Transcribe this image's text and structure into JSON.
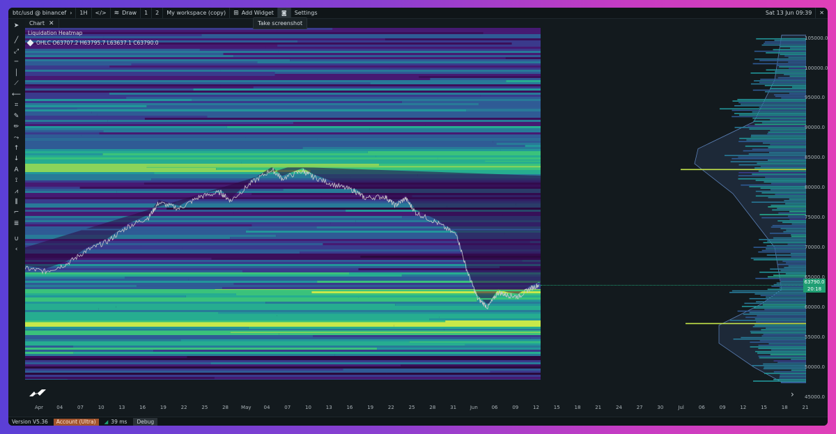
{
  "topbar": {
    "symbol": "btc/usd @ binancef",
    "timeframe": "1H",
    "draw_label": "Draw",
    "layout_1": "1",
    "layout_2": "2",
    "workspace": "My workspace (copy)",
    "add_widget": "Add Widget",
    "settings": "Settings",
    "datetime": "Sat 13 Jun  09:39",
    "close": "✕"
  },
  "tooltip": "Take screenshot",
  "tabs": [
    {
      "label": "Chart"
    }
  ],
  "chart": {
    "title": "Liquidation Heatmap",
    "ohlc": "OHLC  O63707.2 H63795.7 L63637.1 C63790.0",
    "current_price": "63790.0",
    "countdown": "20:18"
  },
  "chart_data": {
    "type": "heatmap",
    "title": "Liquidation Heatmap",
    "ylim": [
      45000,
      106000
    ],
    "y_ticks": [
      "105000.0",
      "100000.0",
      "95000.0",
      "90000.0",
      "85000.0",
      "80000.0",
      "75000.0",
      "70000.0",
      "65000.0",
      "60000.0",
      "55000.0",
      "50000.0",
      "45000.0"
    ],
    "x_ticks": [
      "Apr",
      "04",
      "07",
      "10",
      "13",
      "16",
      "19",
      "22",
      "25",
      "28",
      "May",
      "04",
      "07",
      "10",
      "13",
      "16",
      "19",
      "22",
      "25",
      "28",
      "31",
      "Jun",
      "06",
      "09",
      "12",
      "15",
      "18",
      "21",
      "24",
      "27",
      "30",
      "Jul",
      "06",
      "09",
      "12",
      "15",
      "18",
      "21"
    ],
    "price_path": [
      [
        0,
        66500
      ],
      [
        4,
        66000
      ],
      [
        8,
        67200
      ],
      [
        12,
        69500
      ],
      [
        16,
        71000
      ],
      [
        20,
        73500
      ],
      [
        24,
        75000
      ],
      [
        26,
        77500
      ],
      [
        30,
        76500
      ],
      [
        34,
        78500
      ],
      [
        38,
        79200
      ],
      [
        40,
        77800
      ],
      [
        44,
        80800
      ],
      [
        48,
        83000
      ],
      [
        50,
        81500
      ],
      [
        54,
        82800
      ],
      [
        56,
        81800
      ],
      [
        60,
        80500
      ],
      [
        64,
        79500
      ],
      [
        66,
        78300
      ],
      [
        70,
        78500
      ],
      [
        72,
        77000
      ],
      [
        74,
        78200
      ],
      [
        76,
        75800
      ],
      [
        80,
        74200
      ],
      [
        84,
        72000
      ],
      [
        86,
        66000
      ],
      [
        88,
        61500
      ],
      [
        90,
        60000
      ],
      [
        92,
        62500
      ],
      [
        94,
        62000
      ],
      [
        96,
        61800
      ],
      [
        98,
        63000
      ],
      [
        100,
        63790
      ]
    ],
    "bright_levels": [
      {
        "price": 83500,
        "strength": 0.9
      },
      {
        "price": 84600,
        "strength": 0.7
      },
      {
        "price": 62800,
        "strength": 0.8
      },
      {
        "price": 61400,
        "strength": 0.75
      },
      {
        "price": 58800,
        "strength": 0.7
      },
      {
        "price": 57400,
        "strength": 0.95
      },
      {
        "price": 56000,
        "strength": 0.8
      },
      {
        "price": 54000,
        "strength": 0.7
      },
      {
        "price": 93300,
        "strength": 0.45
      },
      {
        "price": 88000,
        "strength": 0.4
      },
      {
        "price": 73000,
        "strength": 0.45
      }
    ],
    "profile_peaks": [
      {
        "price": 83200,
        "value": 1.0
      },
      {
        "price": 57400,
        "value": 0.95
      },
      {
        "price": 93300,
        "value": 0.6
      },
      {
        "price": 85500,
        "value": 0.55
      },
      {
        "price": 62500,
        "value": 0.5
      }
    ]
  },
  "statusbar": {
    "version": "Version V5.36",
    "account": "Account (Ultra)",
    "latency": "39 ms",
    "debug": "Debug"
  },
  "colors": {
    "accent_green": "#1f9e73",
    "account_orange": "#a2552d",
    "heat_low": "#2a0a3c",
    "heat_high": "#c8e84a"
  }
}
